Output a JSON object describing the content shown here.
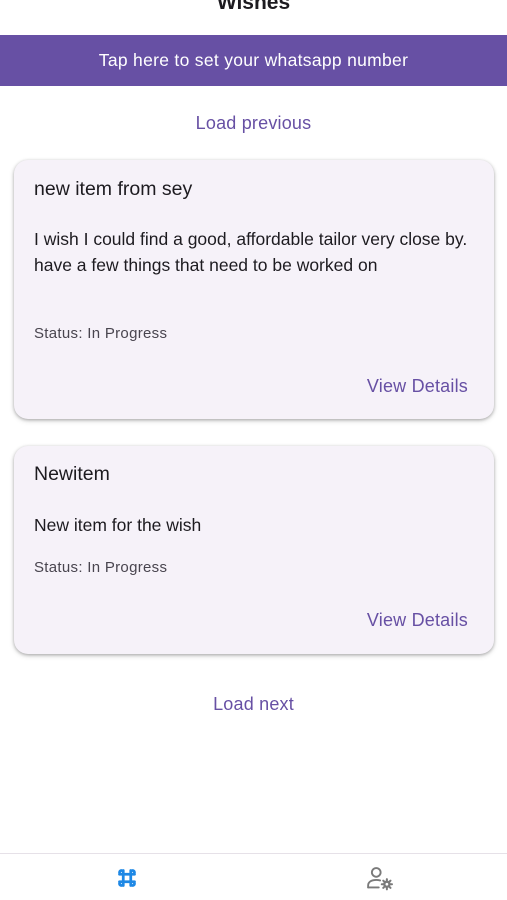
{
  "app_bar": {
    "title": "Wishes"
  },
  "banner": {
    "text": "Tap here to set your whatsapp number"
  },
  "load_previous": "Load previous",
  "load_next": "Load next",
  "wishes": [
    {
      "title": "new item from sey",
      "description": "I wish I could find a good, affordable tailor very close by. have a few things that need to be worked on",
      "status": "Status: In Progress",
      "action": "View Details"
    },
    {
      "title": "Newitem",
      "description": "New item for the wish",
      "status": "Status: In Progress",
      "action": "View Details"
    }
  ],
  "bottom_nav": {
    "items": [
      {
        "icon": "command-icon",
        "active": true
      },
      {
        "icon": "user-settings-icon",
        "active": false
      }
    ]
  },
  "colors": {
    "accent": "#6750a4",
    "card_bg": "#f6f2f9",
    "active_nav": "#1e88e5",
    "inactive_nav": "#7a7a7a"
  }
}
